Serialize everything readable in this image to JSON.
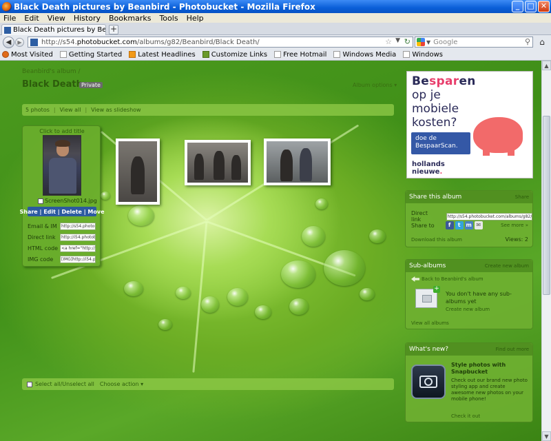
{
  "window": {
    "title": "Black Death pictures by Beanbird - Photobucket - Mozilla Firefox",
    "minimize": "_",
    "maximize": "□",
    "close": "✕"
  },
  "menu": [
    "File",
    "Edit",
    "View",
    "History",
    "Bookmarks",
    "Tools",
    "Help"
  ],
  "tab": {
    "label": "Black Death pictures by Beanbird - P...",
    "close": "×",
    "new_tab": "+"
  },
  "nav": {
    "url_prefix": "http://s54.",
    "url_host": "photobucket.com",
    "url_rest": "/albums/g82/Beanbird/Black Death/",
    "search_placeholder": "Google",
    "back": "◀",
    "forward": "▶",
    "home": "⌂"
  },
  "bookmarks": [
    {
      "label": "Most Visited",
      "icon": "fx"
    },
    {
      "label": "Getting Started",
      "icon": "page"
    },
    {
      "label": "Latest Headlines",
      "icon": "rss"
    },
    {
      "label": "Customize Links",
      "icon": "star"
    },
    {
      "label": "Free Hotmail",
      "icon": "page"
    },
    {
      "label": "Windows Media",
      "icon": "page"
    },
    {
      "label": "Windows",
      "icon": "page"
    }
  ],
  "album": {
    "breadcrumb": "Beanbird's album /",
    "title": "Black Death",
    "badge": "Private",
    "options": "Album options ▾",
    "photo_count": "5 photos",
    "view_all": "View all",
    "slideshow": "View as slideshow",
    "select_all": "Select all/Unselect all",
    "choose_action": "Choose action ▾"
  },
  "panel": {
    "click_title": "Click to add title",
    "filename": "ScreenShot014.jpg",
    "actions": "Share | Edit | Delete | Move",
    "rows": [
      {
        "label": "Email & IM",
        "value": "http://s54.photob"
      },
      {
        "label": "Direct link",
        "value": "http://i54.photobu"
      },
      {
        "label": "HTML code",
        "value": "<a href=\"http://ph"
      },
      {
        "label": "IMG code",
        "value": "[IMG]http://i54.ph"
      }
    ]
  },
  "ad": {
    "line1_a": "Be",
    "line1_b": "spar",
    "line1_c": "en",
    "line2": "op je",
    "line3": "mobiele",
    "line4": "kosten?",
    "cta": "doe de BespaarScan.",
    "brand1": "hollands",
    "brand2_a": "nieuwe",
    "brand2_b": "."
  },
  "share": {
    "heading": "Share this album",
    "heading_link": "Share",
    "direct_label": "Direct link",
    "direct_value": "http://s54.photobucket.com/albums/g82/Be",
    "share_to": "Share to",
    "see_more": "See more »",
    "download": "Download this album",
    "views": "Views: 2"
  },
  "subalbums": {
    "heading": "Sub-albums",
    "heading_link": "Create new album",
    "back": "Back to Beanbird's album",
    "empty_text": "You don't have any sub-albums yet",
    "create": "Create new album",
    "view_all": "View all albums"
  },
  "whatsnew": {
    "heading": "What's new?",
    "heading_link": "Find out more",
    "title": "Style photos with Snapbucket",
    "text": "Check out our brand new photo styling app and create awesome new photos on your mobile phone!",
    "link": "Check it out"
  }
}
